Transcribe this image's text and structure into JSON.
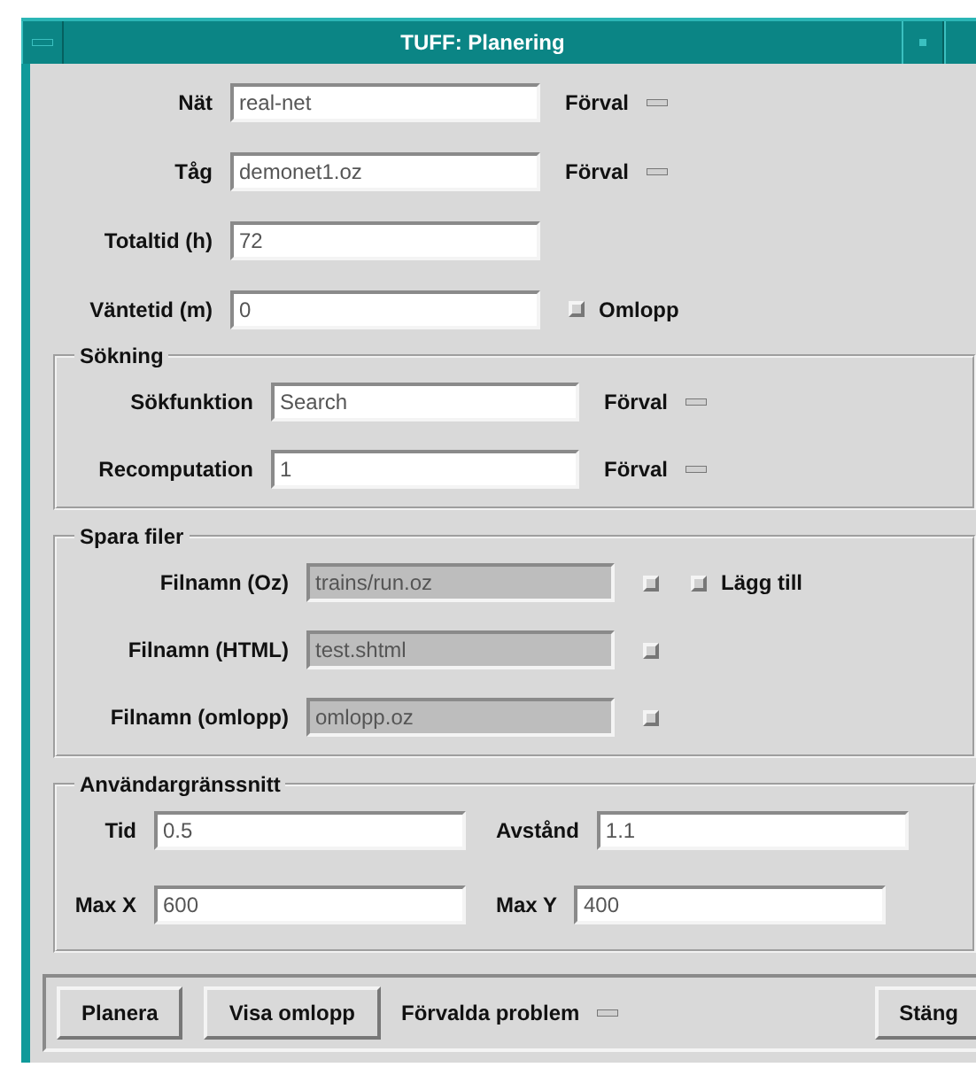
{
  "window": {
    "title": "TUFF: Planering"
  },
  "main_rows": [
    {
      "label": "Nät",
      "value": "real-net",
      "trailing": [
        {
          "kind": "option",
          "label": "Förval"
        }
      ]
    },
    {
      "label": "Tåg",
      "value": "demonet1.oz",
      "trailing": [
        {
          "kind": "option",
          "label": "Förval"
        }
      ]
    },
    {
      "label": "Totaltid (h)",
      "value": "72",
      "trailing": []
    },
    {
      "label": "Väntetid (m)",
      "value": "0",
      "trailing": [
        {
          "kind": "checkbox",
          "label": "Omlopp",
          "checked": false
        }
      ]
    }
  ],
  "search_group": {
    "title": "Sökning",
    "rows": [
      {
        "label": "Sökfunktion",
        "value": "Search",
        "trailing": [
          {
            "kind": "option",
            "label": "Förval"
          }
        ]
      },
      {
        "label": "Recomputation",
        "value": "1",
        "trailing": [
          {
            "kind": "option",
            "label": "Förval"
          }
        ]
      }
    ]
  },
  "files_group": {
    "title": "Spara filer",
    "rows": [
      {
        "label": "Filnamn (Oz)",
        "value": "trains/run.oz",
        "disabled": true,
        "trailing": [
          {
            "kind": "checkbox",
            "checked": false
          },
          {
            "kind": "checkbox",
            "label": "Lägg till",
            "checked": false
          }
        ]
      },
      {
        "label": "Filnamn (HTML)",
        "value": "test.shtml",
        "disabled": true,
        "trailing": [
          {
            "kind": "checkbox",
            "checked": false
          }
        ]
      },
      {
        "label": "Filnamn (omlopp)",
        "value": "omlopp.oz",
        "disabled": true,
        "trailing": [
          {
            "kind": "checkbox",
            "checked": false
          }
        ]
      }
    ]
  },
  "ui_group": {
    "title": "Användargränssnitt",
    "rows": [
      [
        {
          "label": "Tid",
          "value": "0.5"
        },
        {
          "label": "Avstånd",
          "value": "1.1"
        }
      ],
      [
        {
          "label": "Max X",
          "value": "600"
        },
        {
          "label": "Max Y",
          "value": "400"
        }
      ]
    ]
  },
  "bottom_bar": [
    {
      "kind": "button",
      "label": "Planera"
    },
    {
      "kind": "button",
      "label": "Visa omlopp"
    },
    {
      "kind": "option",
      "label": "Förvalda problem"
    },
    {
      "kind": "spacer"
    },
    {
      "kind": "button",
      "label": "Stäng"
    }
  ]
}
